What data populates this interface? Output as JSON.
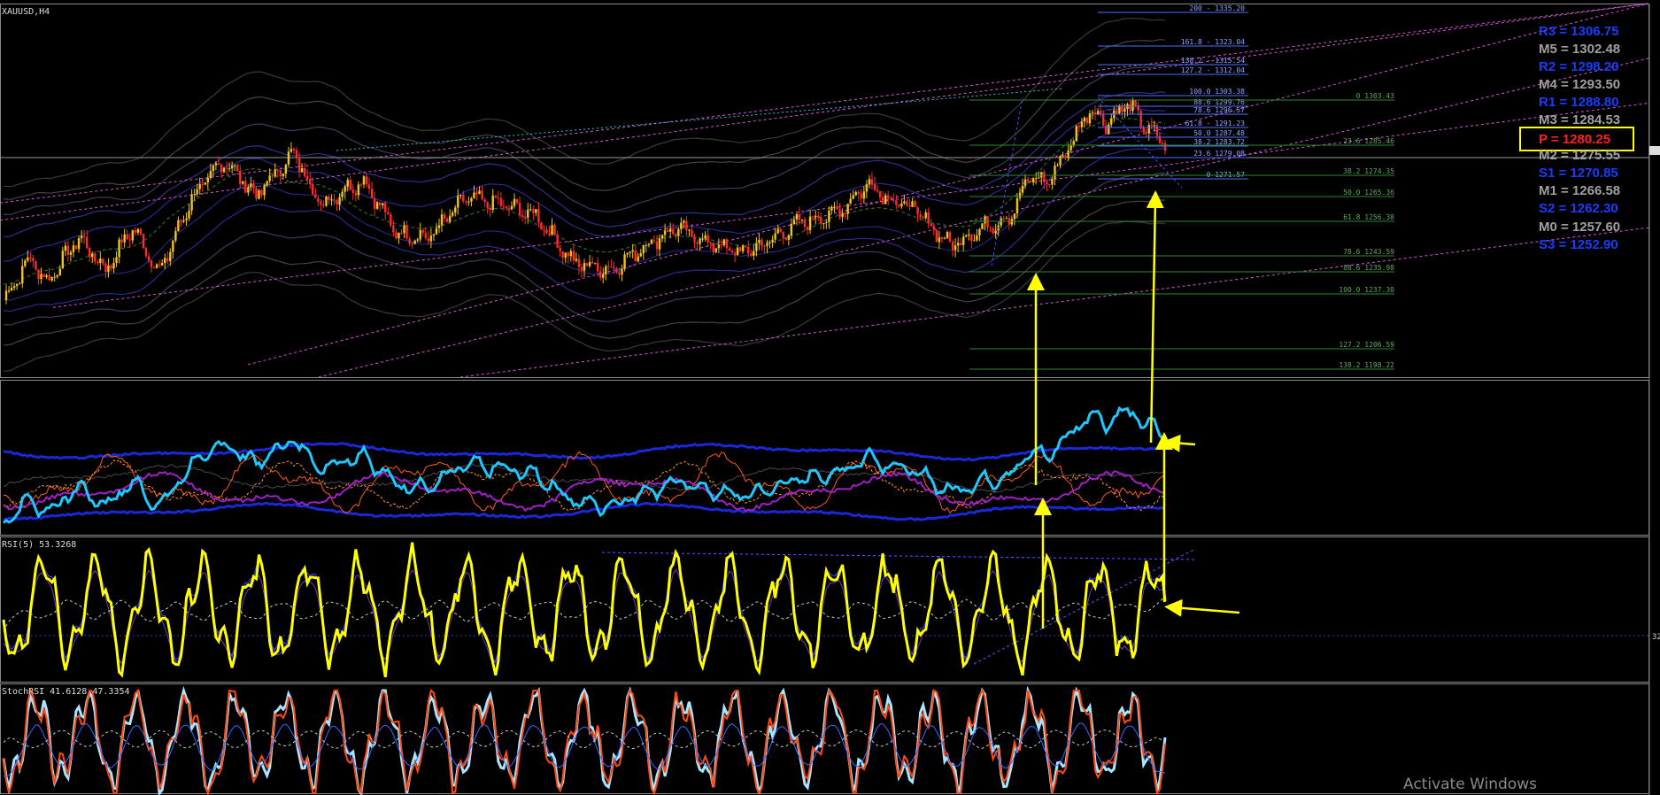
{
  "window": {
    "symbol_label": "XAUUSD,H4"
  },
  "colors": {
    "bg": "#000000",
    "bull": "#f0c419",
    "bear": "#ff2a2a",
    "rsi": "#ffff00",
    "stoch": "#a8e6ff",
    "lrc": "#ff66ff",
    "pivot_blue": "#1a3cff",
    "pivot_gray": "#a0a0a0",
    "pivot_red": "#ff2020",
    "fib": "#4a6fff",
    "fib_green": "#2f8a2f",
    "arrow": "#ffff00"
  },
  "panels": {
    "rsi": {
      "label": "RSI(5) 53.3268",
      "level_label": "32"
    },
    "stochrsi": {
      "label": "StochRSI 41.6128 47.3354"
    }
  },
  "chart_data": {
    "type": "candlestick",
    "symbol": "XAUUSD",
    "timeframe": "H4",
    "ylim": [
      1190,
      1340
    ],
    "current_price": 1281.0,
    "price_path_anchors": [
      [
        0,
        1221
      ],
      [
        10,
        1238
      ],
      [
        16,
        1228
      ],
      [
        28,
        1246
      ],
      [
        38,
        1233
      ],
      [
        48,
        1250
      ],
      [
        58,
        1232
      ],
      [
        70,
        1262
      ],
      [
        82,
        1277
      ],
      [
        94,
        1263
      ],
      [
        108,
        1280
      ],
      [
        118,
        1259
      ],
      [
        126,
        1265
      ],
      [
        134,
        1269
      ],
      [
        146,
        1248
      ],
      [
        158,
        1246
      ],
      [
        172,
        1262
      ],
      [
        186,
        1259
      ],
      [
        198,
        1255
      ],
      [
        212,
        1236
      ],
      [
        226,
        1233
      ],
      [
        236,
        1241
      ],
      [
        250,
        1250
      ],
      [
        262,
        1244
      ],
      [
        274,
        1240
      ],
      [
        282,
        1243
      ],
      [
        296,
        1252
      ],
      [
        310,
        1256
      ],
      [
        322,
        1268
      ],
      [
        330,
        1261
      ],
      [
        338,
        1258
      ],
      [
        352,
        1243
      ],
      [
        366,
        1251
      ],
      [
        374,
        1254
      ],
      [
        382,
        1271
      ],
      [
        388,
        1268
      ],
      [
        396,
        1282
      ],
      [
        404,
        1298
      ],
      [
        410,
        1292
      ],
      [
        418,
        1300
      ],
      [
        425,
        1290
      ],
      [
        432,
        1284
      ]
    ],
    "fib_levels": [
      {
        "label": "200 - 1335.20"
      },
      {
        "label": "161.8 - 1323.04"
      },
      {
        "label": "138.2 - 1315.54"
      },
      {
        "label": "127.2 - 1312.04"
      },
      {
        "label": "100.0 1303.38"
      },
      {
        "label": "88.6 1299.76"
      },
      {
        "label": "78.6 1296.57"
      },
      {
        "label": "61.8 - 1291.23"
      },
      {
        "label": "50.0 1287.48"
      },
      {
        "label": "38.2 1283.72"
      },
      {
        "label": "23.6 1279.08"
      },
      {
        "label": "0 1271.57"
      }
    ],
    "fib_levels_green": [
      {
        "label": "0 1303.43"
      },
      {
        "label": "23.6 1285.46"
      },
      {
        "label": "38.2 1274.35"
      },
      {
        "label": "50.0 1265.36"
      },
      {
        "label": "61.8 1256.38"
      },
      {
        "label": "78.6 1243.59"
      },
      {
        "label": "88.6 1235.98"
      },
      {
        "label": "100.0 1237.30"
      },
      {
        "label": "127.2 1206.59"
      },
      {
        "label": "138.2 1198.22"
      }
    ],
    "pivots": [
      {
        "label": "R3 = 1306.75",
        "color": "blue"
      },
      {
        "label": "M5 = 1302.48",
        "color": "gray"
      },
      {
        "label": "R2 = 1298.20",
        "color": "blue"
      },
      {
        "label": "M4 = 1293.50",
        "color": "gray"
      },
      {
        "label": "R1 = 1288.80",
        "color": "blue"
      },
      {
        "label": "M3 = 1284.53",
        "color": "gray"
      },
      {
        "label": "P = 1280.25",
        "color": "red",
        "boxed": true
      },
      {
        "label": "M2 = 1275.55",
        "color": "gray"
      },
      {
        "label": "S1 = 1270.85",
        "color": "blue"
      },
      {
        "label": "M1 = 1266.58",
        "color": "gray"
      },
      {
        "label": "S2 = 1262.30",
        "color": "blue"
      },
      {
        "label": "M0 = 1257.60",
        "color": "gray"
      },
      {
        "label": "S3 = 1252.90",
        "color": "blue"
      }
    ]
  },
  "footer": {
    "watermark": "Activate Windows"
  }
}
